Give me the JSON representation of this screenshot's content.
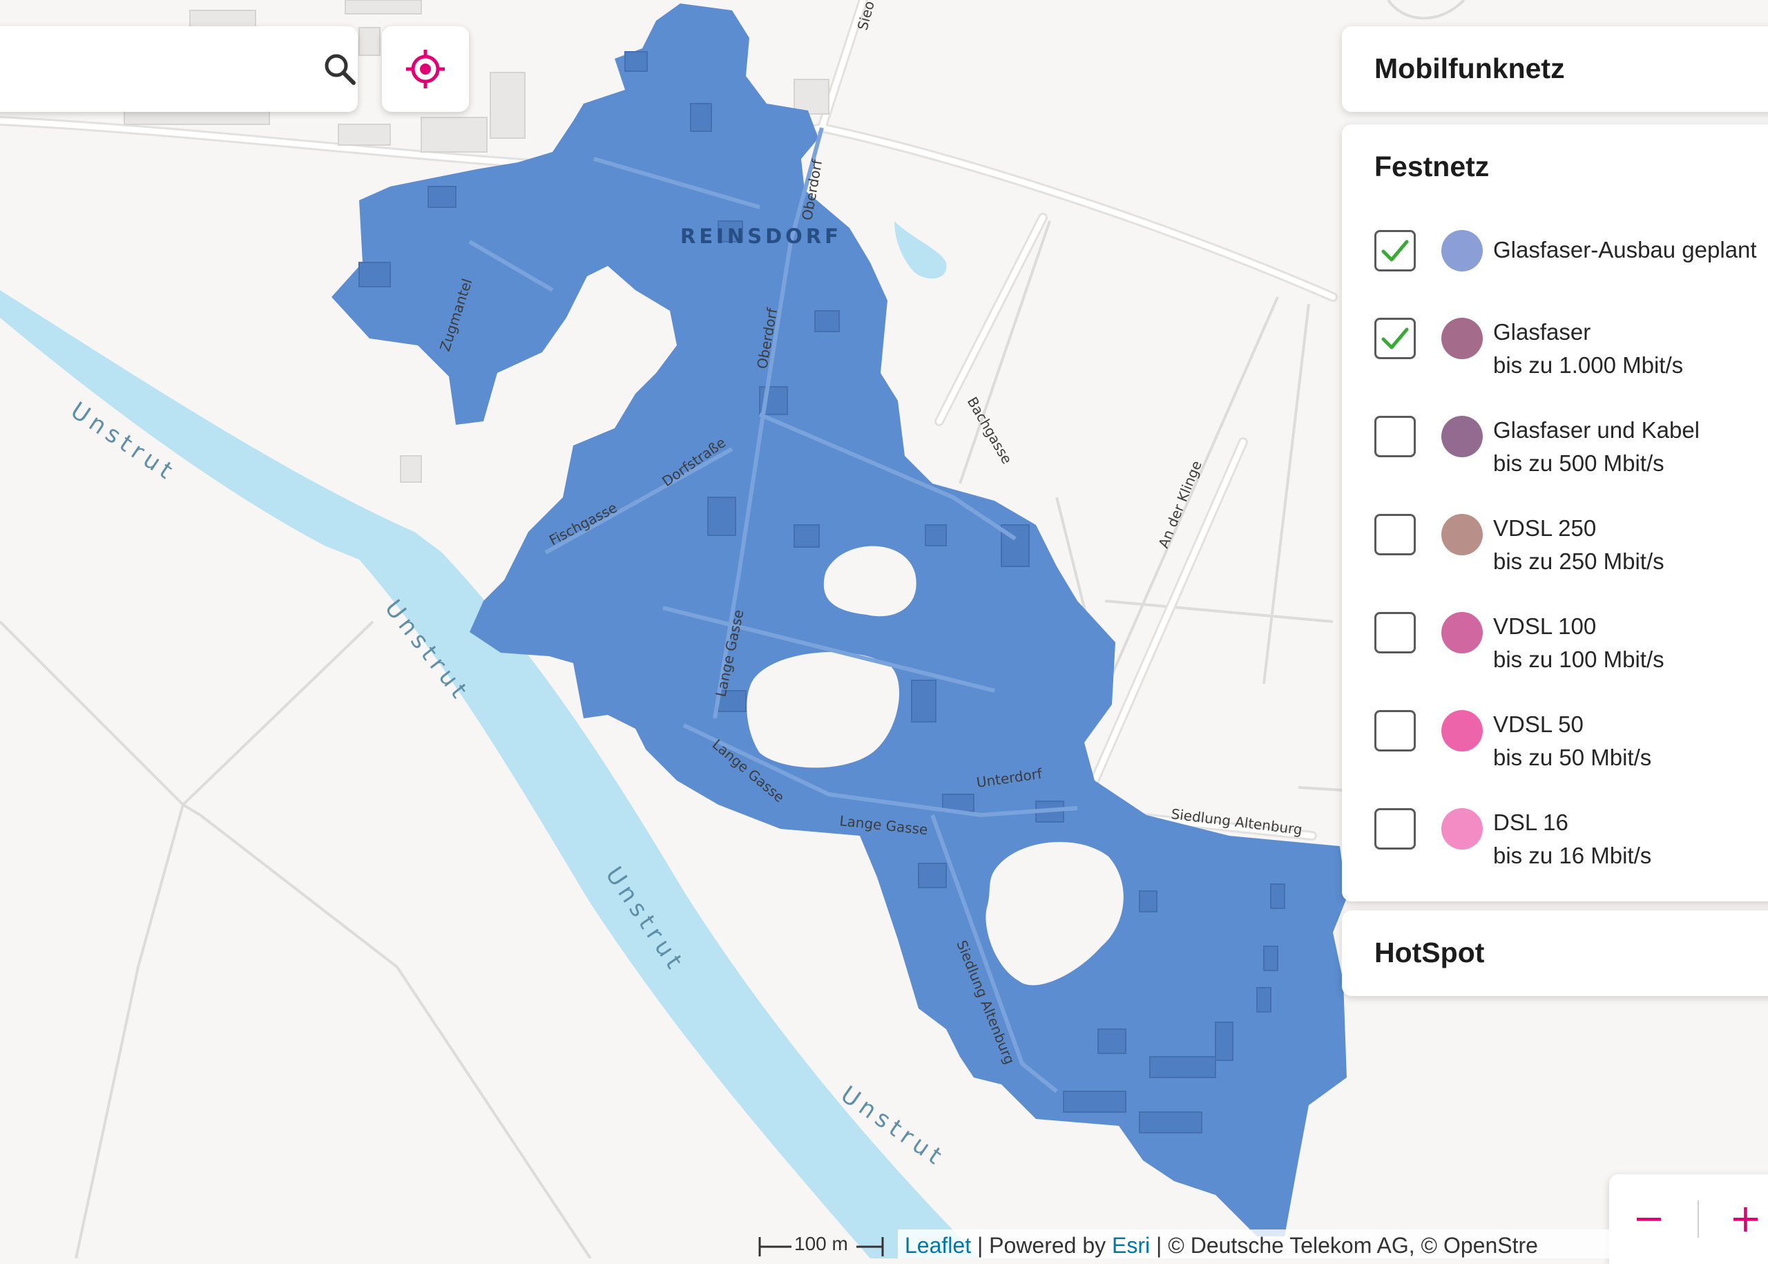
{
  "search": {
    "placeholder": "",
    "value": ""
  },
  "map": {
    "town_label": "REINSDORF",
    "river_label": "Unstrut",
    "streets": {
      "zugmantel": "Zugmantel",
      "oberdorf": "Oberdorf",
      "dorfstrasse": "Dorfstraße",
      "fischgasse": "Fischgasse",
      "lange_gasse": "Lange Gasse",
      "unterdorf": "Unterdorf",
      "siedlung_altenburg": "Siedlung Altenburg",
      "bachgasse": "Bachgasse",
      "an_der_klinge": "An der Klinge",
      "sieo": "Sieo"
    },
    "coverage_color": "#5b8dd0",
    "river_color": "#b9e3f3"
  },
  "panels": {
    "mobilfunk": {
      "title": "Mobilfunknetz"
    },
    "festnetz": {
      "title": "Festnetz",
      "items": [
        {
          "line1": "Glasfaser-Ausbau geplant",
          "line2": "",
          "checked": true,
          "color": "#8b9fd6"
        },
        {
          "line1": "Glasfaser",
          "line2": "bis zu 1.000 Mbit/s",
          "checked": true,
          "color": "#a56b8b"
        },
        {
          "line1": "Glasfaser und Kabel",
          "line2": "bis zu 500 Mbit/s",
          "checked": false,
          "color": "#936b90"
        },
        {
          "line1": "VDSL 250",
          "line2": "bis zu 250 Mbit/s",
          "checked": false,
          "color": "#b99089"
        },
        {
          "line1": "VDSL 100",
          "line2": "bis zu 100 Mbit/s",
          "checked": false,
          "color": "#d067a0"
        },
        {
          "line1": "VDSL 50",
          "line2": "bis zu 50 Mbit/s",
          "checked": false,
          "color": "#ed64aa"
        },
        {
          "line1": "DSL 16",
          "line2": "bis zu 16 Mbit/s",
          "checked": false,
          "color": "#f38bc5"
        }
      ]
    },
    "hotspot": {
      "title": "HotSpot"
    }
  },
  "zoom": {
    "out": "−",
    "in": "+"
  },
  "scale": {
    "label": "100 m"
  },
  "attribution": {
    "leaflet": "Leaflet",
    "sep1": " | Powered by ",
    "esri": "Esri",
    "rest": " | © Deutsche Telekom AG, © OpenStre"
  },
  "colors": {
    "accent": "#e20074",
    "check": "#3aa935"
  }
}
